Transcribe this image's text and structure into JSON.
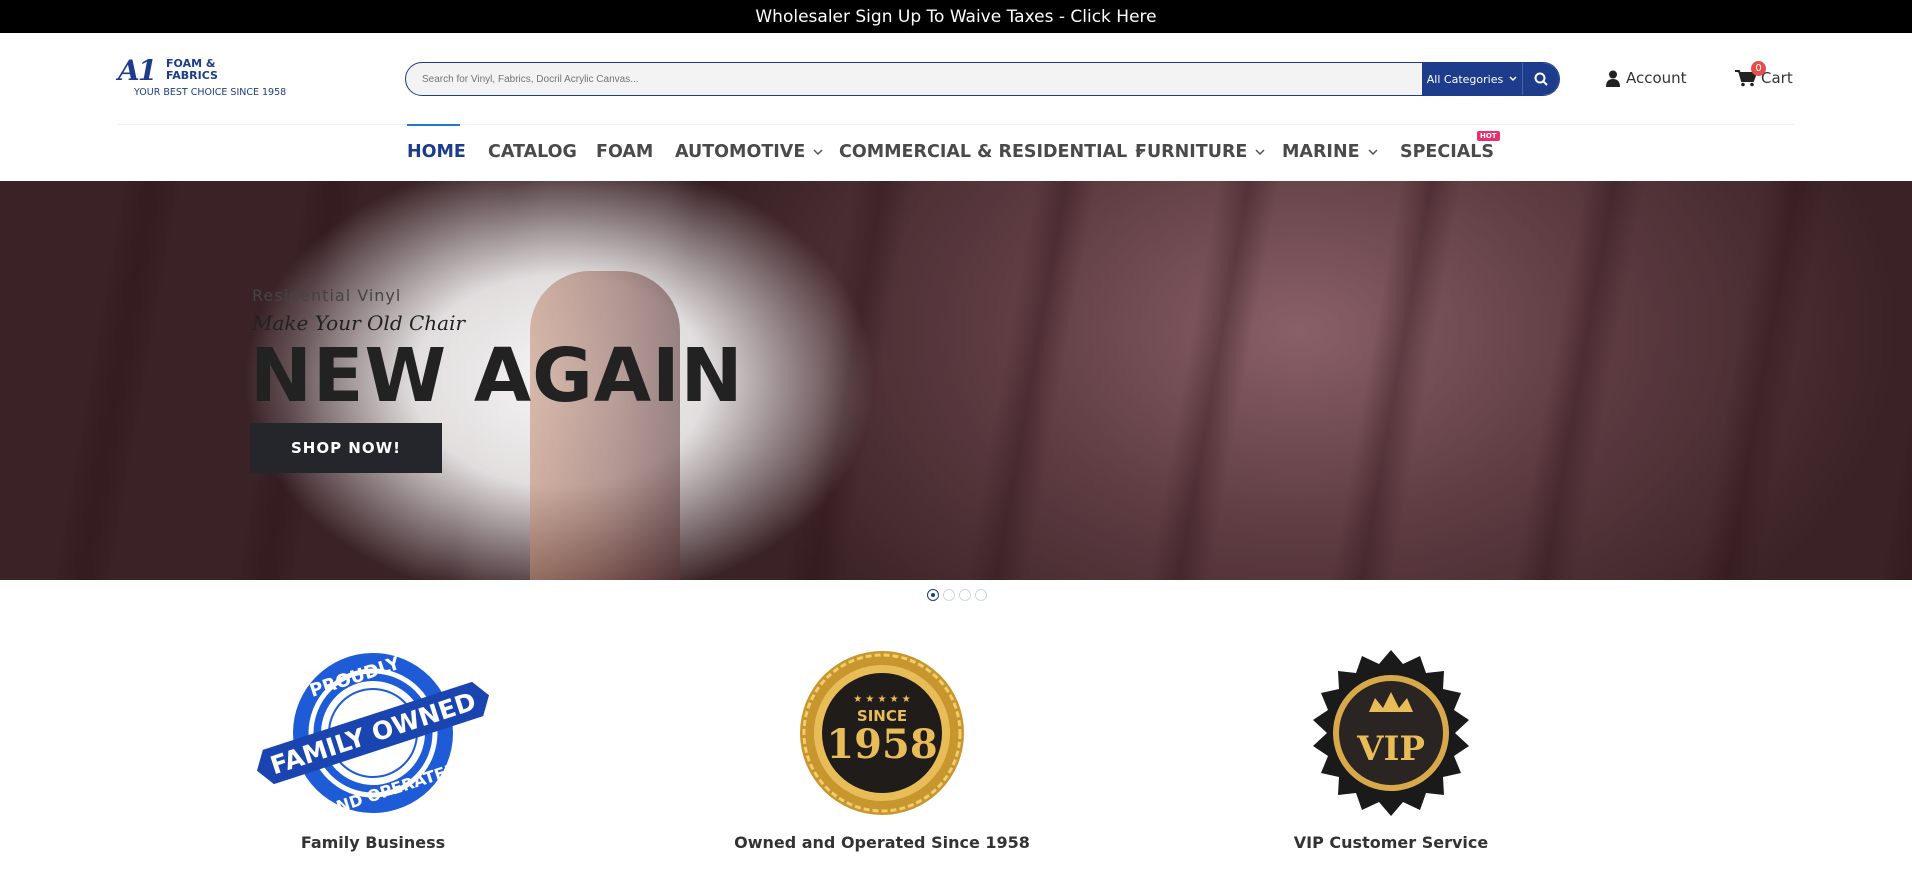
{
  "top_banner": {
    "text": "Wholesaler Sign Up To Waive Taxes - Click Here"
  },
  "logo": {
    "mark": "A1",
    "name_line1": "FOAM &",
    "name_line2": "FABRICS",
    "tagline": "YOUR BEST CHOICE SINCE 1958"
  },
  "search": {
    "placeholder": "Search for Vinyl, Fabrics, Docril Acrylic Canvas...",
    "category": "All Categories"
  },
  "account": {
    "label": "Account"
  },
  "cart": {
    "label": "Cart",
    "count": "0"
  },
  "nav": {
    "items": [
      {
        "label": "HOME",
        "active": true
      },
      {
        "label": "CATALOG"
      },
      {
        "label": "FOAM"
      },
      {
        "label": "AUTOMOTIVE",
        "dropdown": true
      },
      {
        "label": "COMMERCIAL & RESIDENTIAL",
        "dropdown": true
      },
      {
        "label": "FURNITURE",
        "dropdown": true
      },
      {
        "label": "MARINE",
        "dropdown": true
      },
      {
        "label": "SPECIALS"
      }
    ],
    "hot_badge": "HOT"
  },
  "hero": {
    "subtitle": "Residential Vinyl",
    "script": "Make Your Old Chair",
    "headline": "NEW AGAIN",
    "cta": "SHOP NOW!",
    "slides": 4,
    "active_slide": 1
  },
  "features": [
    {
      "caption": "Family Business",
      "badge_top": "PROUDLY",
      "badge_band": "FAMILY OWNED",
      "badge_bottom": "AND OPERATED"
    },
    {
      "caption": "Owned and Operated Since 1958",
      "badge_top": "SINCE",
      "badge_main": "1958"
    },
    {
      "caption": "VIP Customer Service",
      "badge_main": "VIP"
    }
  ],
  "colors": {
    "brand": "#1d3c8c",
    "nav_active_underline": "#1d7cc3",
    "hot": "#e8306e",
    "cta": "#24262c"
  }
}
